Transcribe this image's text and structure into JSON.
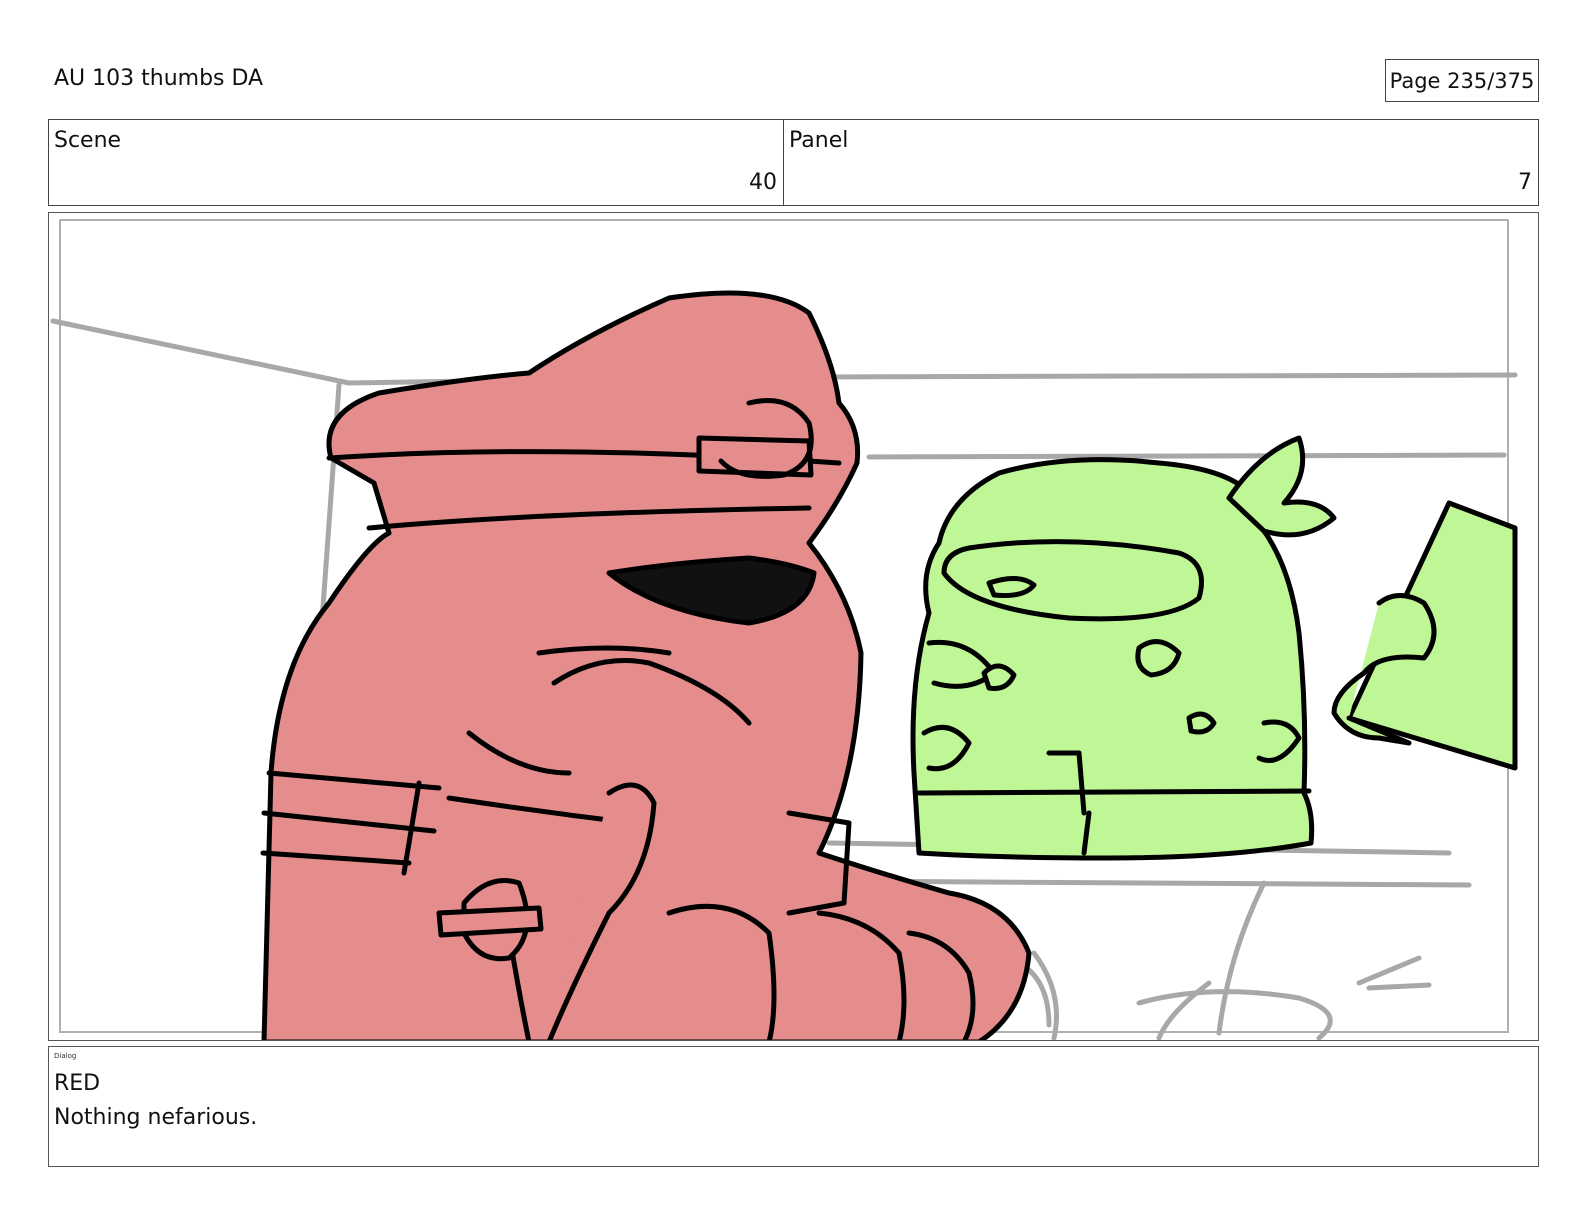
{
  "header": {
    "title": "AU 103 thumbs DA",
    "page": "Page 235/375"
  },
  "info": {
    "scene_label": "Scene",
    "scene_value": "40",
    "panel_label": "Panel",
    "panel_value": "7"
  },
  "panel_image": {
    "characters": [
      "red-character",
      "green-character"
    ],
    "colors": {
      "red": "#e58c8c",
      "green": "#bff797",
      "sketch": "#a8a8a8",
      "ink": "#000000"
    }
  },
  "dialog": {
    "label": "Dialog",
    "character": "RED",
    "line": "Nothing nefarious."
  }
}
